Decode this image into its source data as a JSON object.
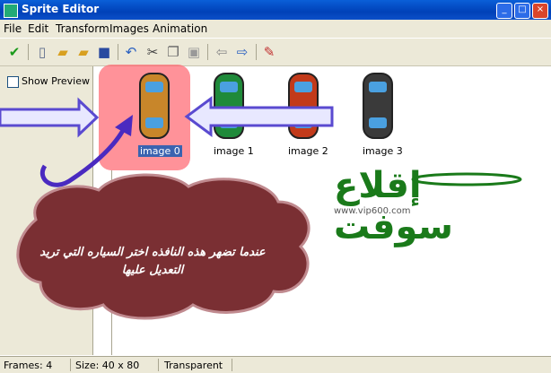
{
  "window": {
    "title": "Sprite Editor"
  },
  "menu": [
    "File",
    "Edit",
    "Transform",
    "Images",
    "Animation"
  ],
  "toolbar": {
    "icons": [
      "check-icon",
      "new-icon",
      "open-icon",
      "add-folder-icon",
      "save-icon",
      "undo-icon",
      "cut-icon",
      "copy-icon",
      "paste-icon",
      "arrow-left-icon",
      "arrow-right-icon",
      "pencil-icon"
    ]
  },
  "left_panel": {
    "show_preview_label": "Show Preview",
    "show_preview_checked": false
  },
  "images": [
    {
      "label": "image 0",
      "color": "#c8862a",
      "selected": true
    },
    {
      "label": "image 1",
      "color": "#1f8a3a",
      "selected": false
    },
    {
      "label": "image 2",
      "color": "#c23a1a",
      "selected": false
    },
    {
      "label": "image 3",
      "color": "#3a3a3a",
      "selected": false
    }
  ],
  "overlay": {
    "instruction": "عندما تضهر هذه النافذه اختر السياره التي تريد التعديل عليها",
    "logo": "إقلاع سوفت",
    "logo_url": "www.vip600.com"
  },
  "status": {
    "frames": "Frames: 4",
    "size": "Size: 40 x 80",
    "transparency": "Transparent"
  },
  "colors": {
    "highlight": "#ff6470",
    "bubble": "#7a2f33",
    "arrow": "#5a4ad0",
    "logo": "#1a7a1a"
  }
}
